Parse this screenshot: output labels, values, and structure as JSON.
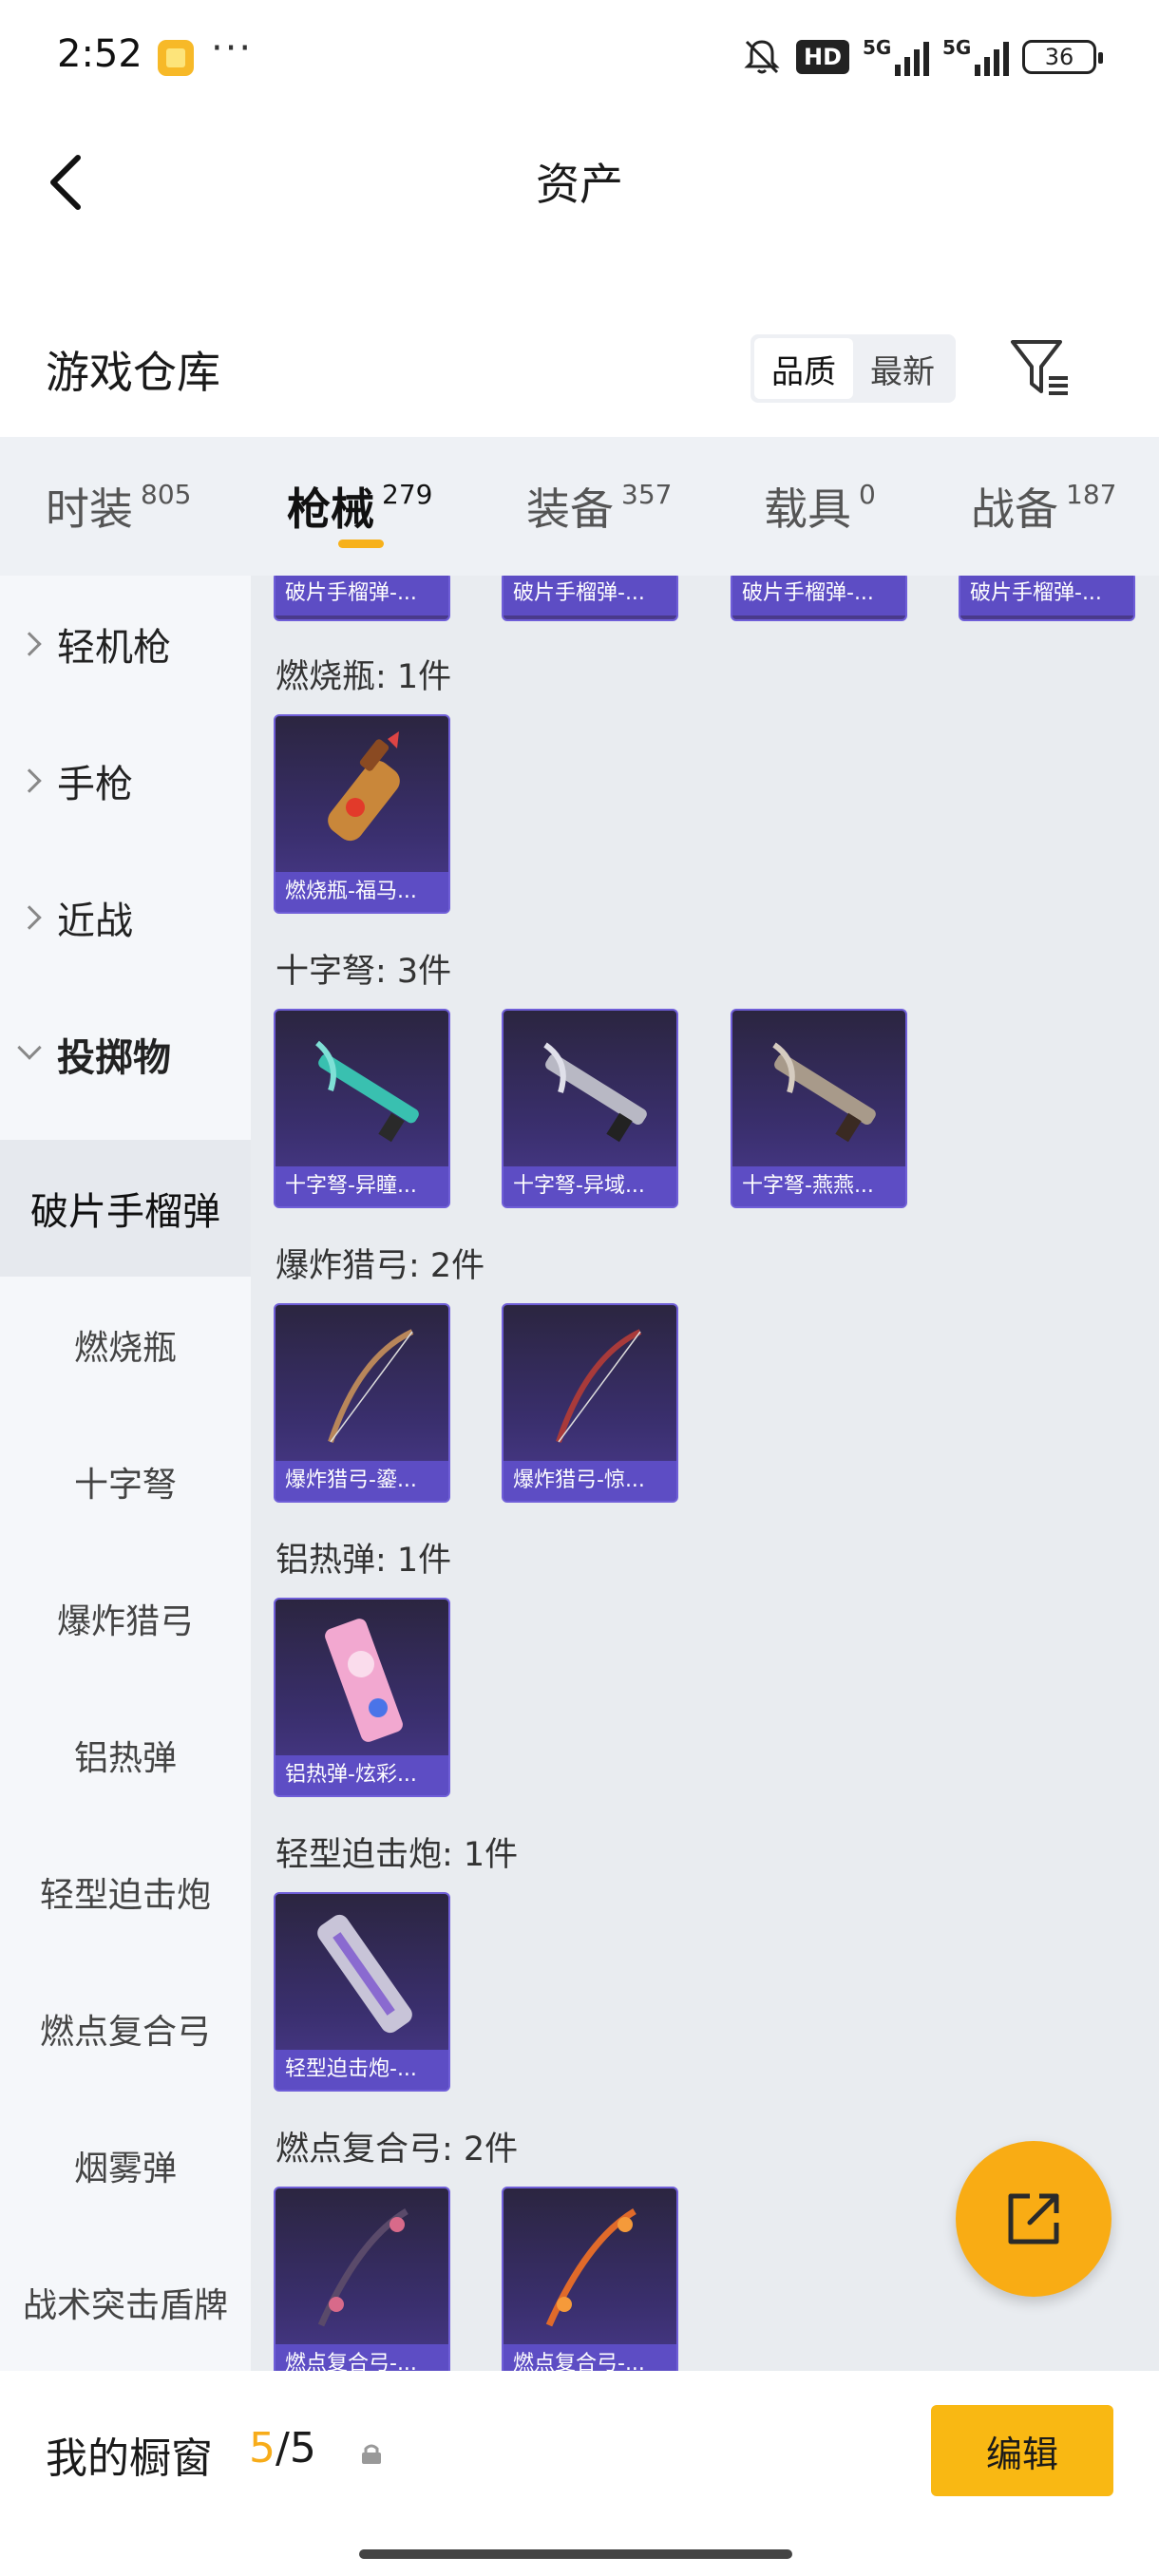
{
  "status_bar": {
    "time": "2:52",
    "more": "···",
    "hd": "HD",
    "net1": "5G",
    "net2": "5G",
    "battery": "36"
  },
  "header": {
    "title": "资产"
  },
  "warehouse": {
    "title": "游戏仓库",
    "sort_options": [
      "品质",
      "最新"
    ],
    "active_sort": "品质"
  },
  "tabs": [
    {
      "label": "时装",
      "count": "805"
    },
    {
      "label": "枪械",
      "count": "279"
    },
    {
      "label": "装备",
      "count": "357"
    },
    {
      "label": "载具",
      "count": "0"
    },
    {
      "label": "战备",
      "count": "187"
    }
  ],
  "active_tab": "枪械",
  "sidebar": {
    "groups": [
      {
        "label": "轻机枪"
      },
      {
        "label": "手枪"
      },
      {
        "label": "近战"
      },
      {
        "label": "投掷物"
      }
    ],
    "subitems": [
      {
        "label": "破片手榴弹"
      },
      {
        "label": "燃烧瓶"
      },
      {
        "label": "十字弩"
      },
      {
        "label": "爆炸猎弓"
      },
      {
        "label": "铝热弹"
      },
      {
        "label": "轻型迫击炮"
      },
      {
        "label": "燃点复合弓"
      },
      {
        "label": "烟雾弹"
      },
      {
        "label": "战术突击盾牌"
      }
    ],
    "selected": "破片手榴弹"
  },
  "content": {
    "top_row_labels": [
      "破片手榴弹-...",
      "破片手榴弹-...",
      "破片手榴弹-...",
      "破片手榴弹-..."
    ],
    "sections": [
      {
        "title": "燃烧瓶: 1件",
        "items": [
          "燃烧瓶-福马..."
        ]
      },
      {
        "title": "十字弩: 3件",
        "items": [
          "十字弩-异瞳...",
          "十字弩-异域...",
          "十字弩-燕燕..."
        ]
      },
      {
        "title": "爆炸猎弓: 2件",
        "items": [
          "爆炸猎弓-鎏...",
          "爆炸猎弓-惊..."
        ]
      },
      {
        "title": "铝热弹: 1件",
        "items": [
          "铝热弹-炫彩..."
        ]
      },
      {
        "title": "轻型迫击炮: 1件",
        "items": [
          "轻型迫击炮-..."
        ]
      },
      {
        "title": "燃点复合弓: 2件",
        "items": [
          "燃点复合弓-...",
          "燃点复合弓-..."
        ]
      }
    ]
  },
  "bottom_bar": {
    "label": "我的橱窗",
    "count_current": "5",
    "count_sep": "/",
    "count_total": "5",
    "edit_label": "编辑"
  }
}
